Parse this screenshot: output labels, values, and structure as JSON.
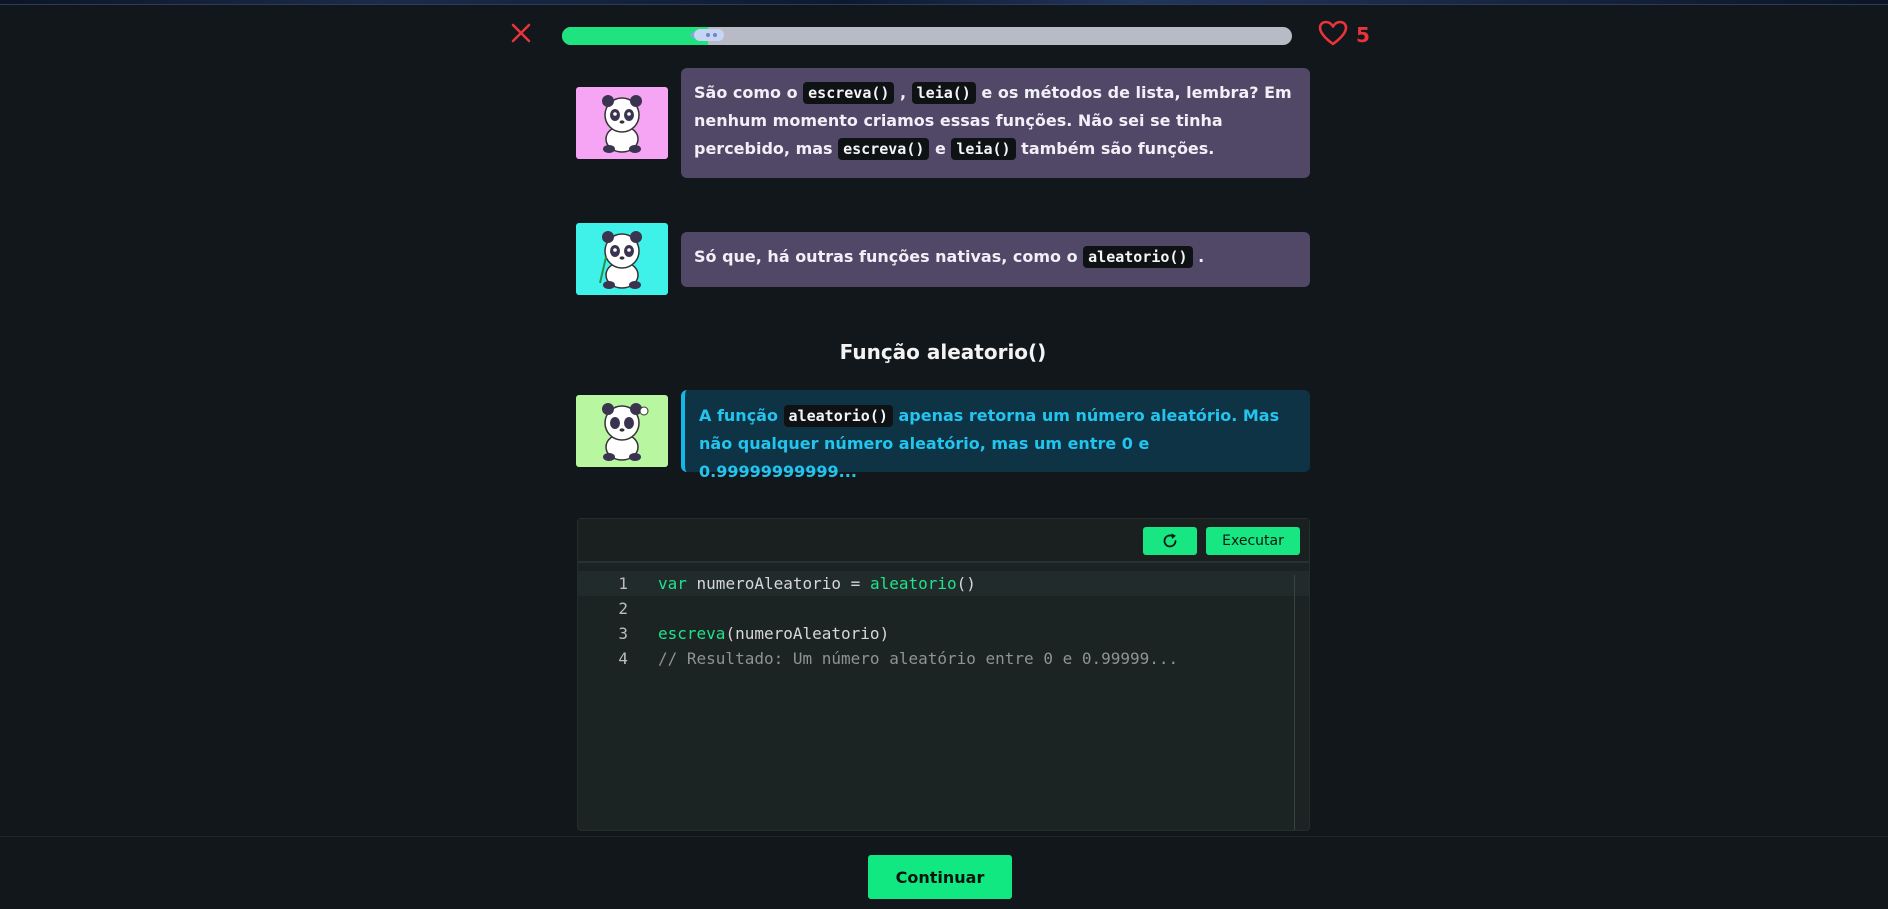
{
  "header": {
    "progress": 0.2,
    "lives": "5",
    "colors": {
      "progress_fill": "#1fe37f",
      "progress_track": "#b8bbc6",
      "heart": "#e8343a"
    }
  },
  "messages": [
    {
      "avatar_color": "#f6a4f4",
      "parts": [
        {
          "t": "São como o "
        },
        {
          "code": "escreva()"
        },
        {
          "t": " , "
        },
        {
          "code": "leia()"
        },
        {
          "t": " e os métodos de lista, lembra? Em nenhum momento criamos essas funções. Não sei se tinha percebido, mas "
        },
        {
          "code": "escreva()"
        },
        {
          "t": " e "
        },
        {
          "code": "leia()"
        },
        {
          "t": " também são funções."
        }
      ]
    },
    {
      "avatar_color": "#3ef2ea",
      "parts": [
        {
          "t": "Só que, há outras funções nativas, como o "
        },
        {
          "code": "aleatorio()"
        },
        {
          "t": " ."
        }
      ]
    }
  ],
  "section_title": "Função aleatorio()",
  "info": {
    "avatar_color": "#b8f7a0",
    "parts": [
      {
        "t": "A função "
      },
      {
        "code": "aleatorio()"
      },
      {
        "t": " apenas retorna um número aleatório. Mas não qualquer número aleatório, mas um entre 0 e 0.99999999999..."
      }
    ]
  },
  "editor": {
    "run_label": "Executar",
    "reset_icon": "refresh-icon",
    "lines": [
      {
        "n": "1",
        "tokens": [
          {
            "c": "kw",
            "t": "var"
          },
          {
            "c": "",
            "t": " numeroAleatorio = "
          },
          {
            "c": "kw",
            "t": "aleatorio"
          },
          {
            "c": "",
            "t": "()"
          }
        ]
      },
      {
        "n": "2",
        "tokens": []
      },
      {
        "n": "3",
        "tokens": [
          {
            "c": "kw",
            "t": "escreva"
          },
          {
            "c": "",
            "t": "(numeroAleatorio)"
          }
        ]
      },
      {
        "n": "4",
        "tokens": [
          {
            "c": "cm",
            "t": "// Resultado: Um número aleatório entre 0 e 0.99999..."
          }
        ]
      }
    ]
  },
  "footer": {
    "continue_label": "Continuar"
  }
}
